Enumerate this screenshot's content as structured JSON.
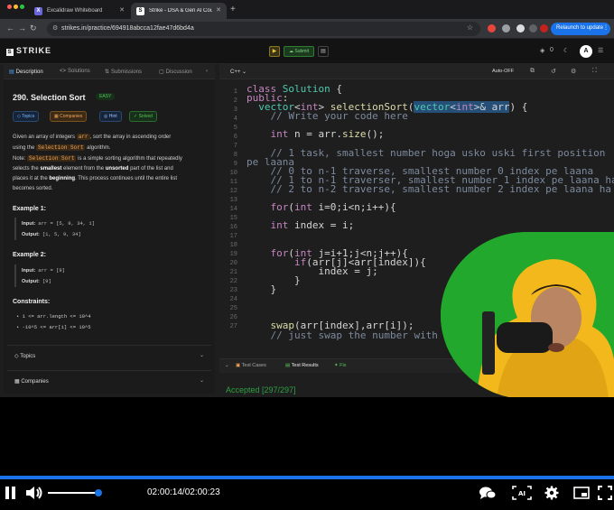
{
  "browser": {
    "tabs": [
      {
        "label": "Excalidraw Whiteboard"
      },
      {
        "label": "Strike - DSA & Gen AI Course"
      }
    ],
    "url": "strikes.in/practice/694918abcca12fae47d6bd4a",
    "relaunch_label": "Relaunch to update"
  },
  "app": {
    "logo": "STRIKE",
    "submit_label": "Submit",
    "count": "0",
    "avatar": "A"
  },
  "problem": {
    "tabs": [
      "Description",
      "Solutions",
      "Submissions",
      "Discussion"
    ],
    "title": "290. Selection Sort",
    "difficulty": "EASY",
    "chips": [
      "Topics",
      "Companies",
      "Hint",
      "Solved"
    ],
    "desc": {
      "l1a": "Given an array of integers",
      "l1code": "arr",
      "l1b": ", sort the array in ascending order",
      "l2a": "using the",
      "l2code": "Selection Sort",
      "l2b": "algorithm.",
      "l3a": "Note:",
      "l3code": "Selection Sort",
      "l3b": "is a simple sorting algorithm that repeatedly",
      "l4a": "selects the",
      "l4b": "smallest",
      "l4c": "element from the",
      "l4d": "unsorted",
      "l4e": "part of the list and",
      "l5a": "places it at the",
      "l5b": "beginning",
      "l5c": ". This process continues until the entire list",
      "l6": "becomes sorted."
    },
    "examples": [
      {
        "title": "Example 1:",
        "input_label": "Input:",
        "input": "arr = [5, 9, 34, 1]",
        "output_label": "Output:",
        "output": "[1, 5, 9, 34]"
      },
      {
        "title": "Example 2:",
        "input_label": "Input:",
        "input": "arr = [9]",
        "output_label": "Output:",
        "output": "[9]"
      }
    ],
    "constraints_title": "Constraints:",
    "constraints": [
      "1 <= arr.length <= 10^4",
      "-10^5 <= arr[i] <= 10^5"
    ],
    "accordions": [
      "Topics",
      "Companies"
    ]
  },
  "editor": {
    "language": "C++",
    "auto": "Auto-OFF",
    "line_numbers": [
      "1",
      "2",
      "3",
      "4",
      "5",
      "6",
      "7",
      "8",
      "9",
      "10",
      "11",
      "12",
      "13",
      "14",
      "15",
      "16",
      "17",
      "18",
      "19",
      "20",
      "21",
      "22",
      "23",
      "24",
      "25",
      "26",
      "27"
    ],
    "bottom_tabs": [
      "Test Cases",
      "Test Results",
      "Fix"
    ],
    "accepted": "Accepted [297/297]"
  },
  "player": {
    "time": "02:00:14/02:00:23",
    "progress_fraction": 0.999,
    "volume_fraction": 0.9
  },
  "colors": {
    "accent": "#1a73e8",
    "easy_green": "#57c35a",
    "webcam_green": "#1fa62a"
  }
}
